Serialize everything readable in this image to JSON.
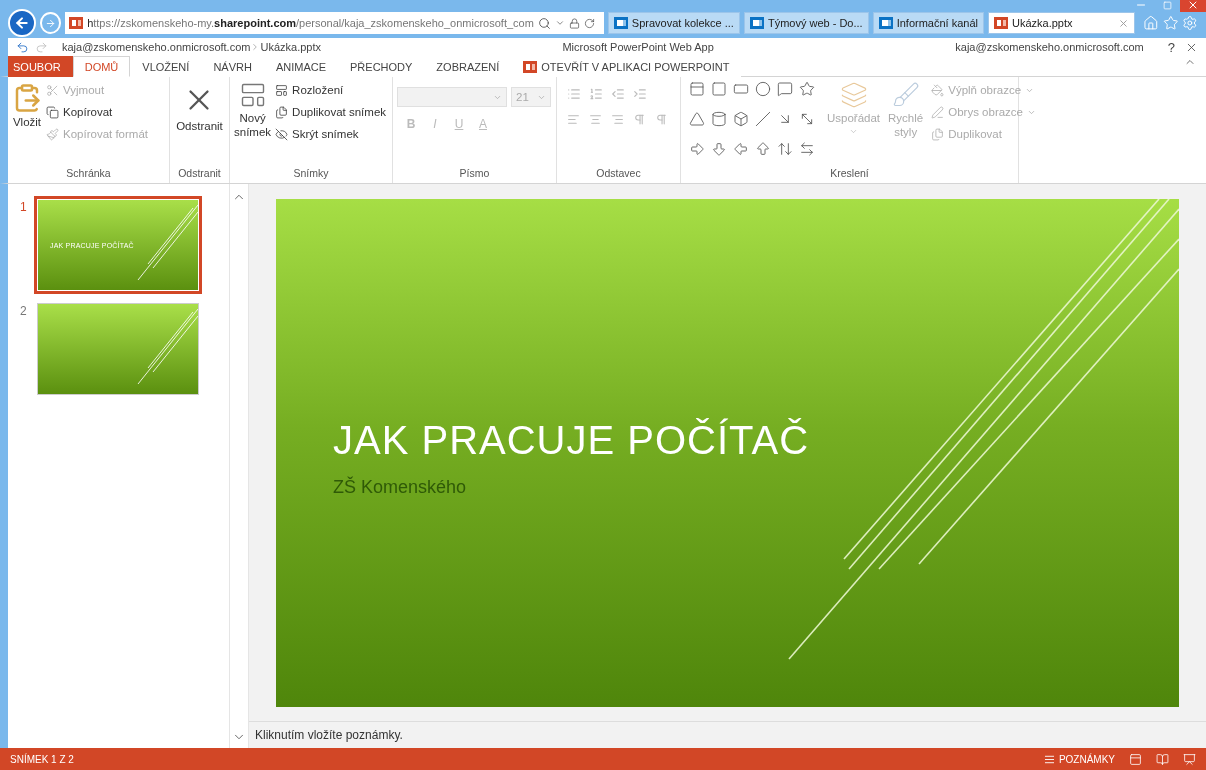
{
  "browser": {
    "url": "https://zskomenskeho-my.**sharepoint.com**/personal/kaja_zskomenskeho_onmicrosoft_com",
    "tabs": [
      {
        "label": "Spravovat kolekce ...",
        "kind": "sharepoint",
        "selected": false
      },
      {
        "label": "Týmový web - Do...",
        "kind": "sharepoint",
        "selected": false
      },
      {
        "label": "Informační kanál",
        "kind": "sharepoint",
        "selected": false
      },
      {
        "label": "Ukázka.pptx",
        "kind": "powerpoint",
        "selected": true
      }
    ]
  },
  "app_bar": {
    "breadcrumb": [
      "kaja@zskomenskeho.onmicrosoft.com",
      "Ukázka.pptx"
    ],
    "title": "Microsoft PowerPoint Web App",
    "user": "kaja@zskomenskeho.onmicrosoft.com",
    "help": "?"
  },
  "ribbon_tabs": [
    {
      "label": "SOUBOR",
      "kind": "file",
      "selected": false
    },
    {
      "label": "DOMŮ",
      "kind": "tab",
      "selected": true
    },
    {
      "label": "VLOŽENÍ",
      "kind": "tab",
      "selected": false
    },
    {
      "label": "NÁVRH",
      "kind": "tab",
      "selected": false
    },
    {
      "label": "ANIMACE",
      "kind": "tab",
      "selected": false
    },
    {
      "label": "PŘECHODY",
      "kind": "tab",
      "selected": false
    },
    {
      "label": "ZOBRAZENÍ",
      "kind": "tab",
      "selected": false
    },
    {
      "label": "OTEVŘÍT V APLIKACI POWERPOINT",
      "kind": "open",
      "selected": false
    }
  ],
  "ribbon": {
    "clipboard": {
      "label": "Schránka",
      "paste": {
        "label": "Vložit"
      },
      "items": [
        {
          "label": "Vyjmout",
          "disabled": true
        },
        {
          "label": "Kopírovat",
          "disabled": false
        },
        {
          "label": "Kopírovat formát",
          "disabled": true
        }
      ]
    },
    "delete": {
      "label": "Odstranit",
      "button": "Odstranit"
    },
    "slides": {
      "label": "Snímky",
      "new": [
        "Nový",
        "snímek"
      ],
      "items": [
        {
          "label": "Rozložení",
          "disabled": false
        },
        {
          "label": "Duplikovat snímek",
          "disabled": false
        },
        {
          "label": "Skrýt snímek",
          "disabled": false
        }
      ]
    },
    "font": {
      "label": "Písmo",
      "size": "21",
      "bold": "B",
      "italic": "I",
      "underline": "U",
      "font_color": "A"
    },
    "paragraph": {
      "label": "Odstavec"
    },
    "drawing": {
      "label": "Kreslení",
      "arrange": [
        "Uspořádat"
      ],
      "styles": [
        "Rychlé",
        "styly"
      ],
      "items": [
        {
          "label": "Výplň obrazce",
          "menu": true
        },
        {
          "label": "Obrys obrazce",
          "menu": true
        },
        {
          "label": "Duplikovat",
          "menu": false
        }
      ]
    }
  },
  "slides": [
    {
      "number": "1",
      "selected": true,
      "title": "JAK PRACUJE POČÍTAČ"
    },
    {
      "number": "2",
      "selected": false
    }
  ],
  "slide": {
    "title": "JAK PRACUJE POČÍTAČ",
    "subtitle": "ZŠ Komenského"
  },
  "notes": {
    "placeholder": "Kliknutím vložíte poznámky."
  },
  "status_bar": {
    "slide_count": "SNÍMEK 1 Z 2",
    "notes": "POZNÁMKY"
  }
}
